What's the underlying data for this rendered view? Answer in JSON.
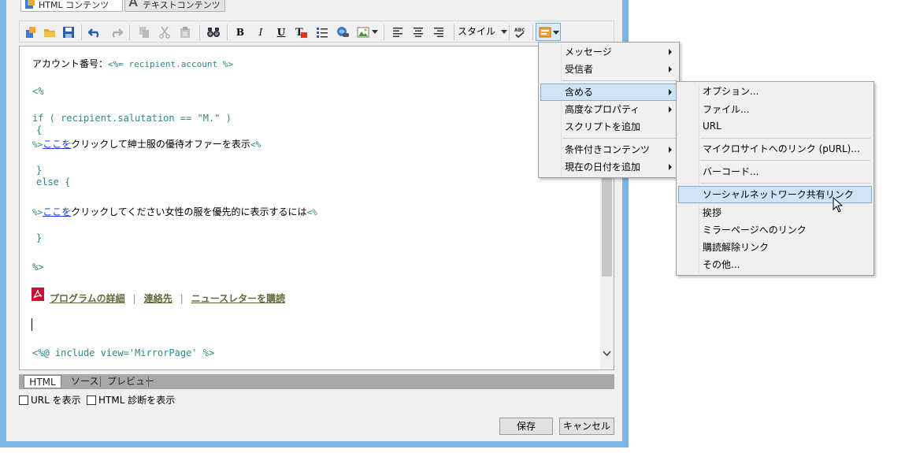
{
  "tabs": {
    "html_content": "HTML コンテンツ",
    "text_content": "テキストコンテンツ"
  },
  "toolbar": {
    "style_label": "スタイル",
    "bold": "B",
    "italic": "I",
    "underline": "U",
    "color": "T",
    "icons": [
      "new-icon",
      "open-folder-icon",
      "save-icon",
      "undo-icon",
      "redo-icon",
      "copy-icon",
      "cut-icon",
      "paste-icon",
      "find-icon",
      "bold-icon",
      "italic-icon",
      "underline-icon",
      "text-color-icon",
      "list-icon",
      "link-icon",
      "image-icon",
      "align-left-icon",
      "align-center-icon",
      "align-right-icon",
      "spellcheck-icon",
      "insert-menu-icon"
    ]
  },
  "editor": {
    "account_label": "アカウント番号：",
    "account_code": "<%= recipient.account %>",
    "open_tag": "<%",
    "if_line": "if ( recipient.salutation == \"M.\" )",
    "open_brace": "{",
    "tag_close": "%>",
    "link_here": "ここを",
    "mens_text": "クリックして紳士服の優待オファーを表示",
    "tag_open_inline": "<%",
    "close_brace": "}",
    "else_line": "else {",
    "womens_text": "クリックしてください女性の服を優先的に表示するには",
    "end_tag": "%>",
    "links": {
      "program": "プログラムの詳細",
      "contact": "連絡先",
      "newsletter": "ニュースレターを購読",
      "separator": "|"
    },
    "include": "<%@ include view='MirrorPage' %>"
  },
  "bottom_tabs": [
    "HTML",
    "ソース",
    "プレビュー"
  ],
  "checkboxes": {
    "show_url": "URL を表示",
    "show_diag": "HTML 診断を表示"
  },
  "buttons": {
    "save": "保存",
    "cancel": "キャンセル"
  },
  "menu_main": {
    "items": [
      "メッセージ",
      "受信者",
      "含める",
      "高度なプロパティ",
      "スクリプトを追加",
      "条件付きコンテンツ",
      "現在の日付を追加"
    ]
  },
  "menu_include": {
    "items": [
      "オプション...",
      "ファイル...",
      "URL",
      "マイクロサイトへのリンク (pURL)...",
      "バーコード...",
      "ソーシャルネットワーク共有リンク",
      "挨拶",
      "ミラーページへのリンク",
      "購読解除リンク",
      "その他..."
    ]
  },
  "colors": {
    "highlight": "#cfe3f5",
    "highlight_border": "#84acdd",
    "code": "#2a8a8a",
    "link": "#1a3fcf",
    "window_frame": "#7eb4e2"
  }
}
